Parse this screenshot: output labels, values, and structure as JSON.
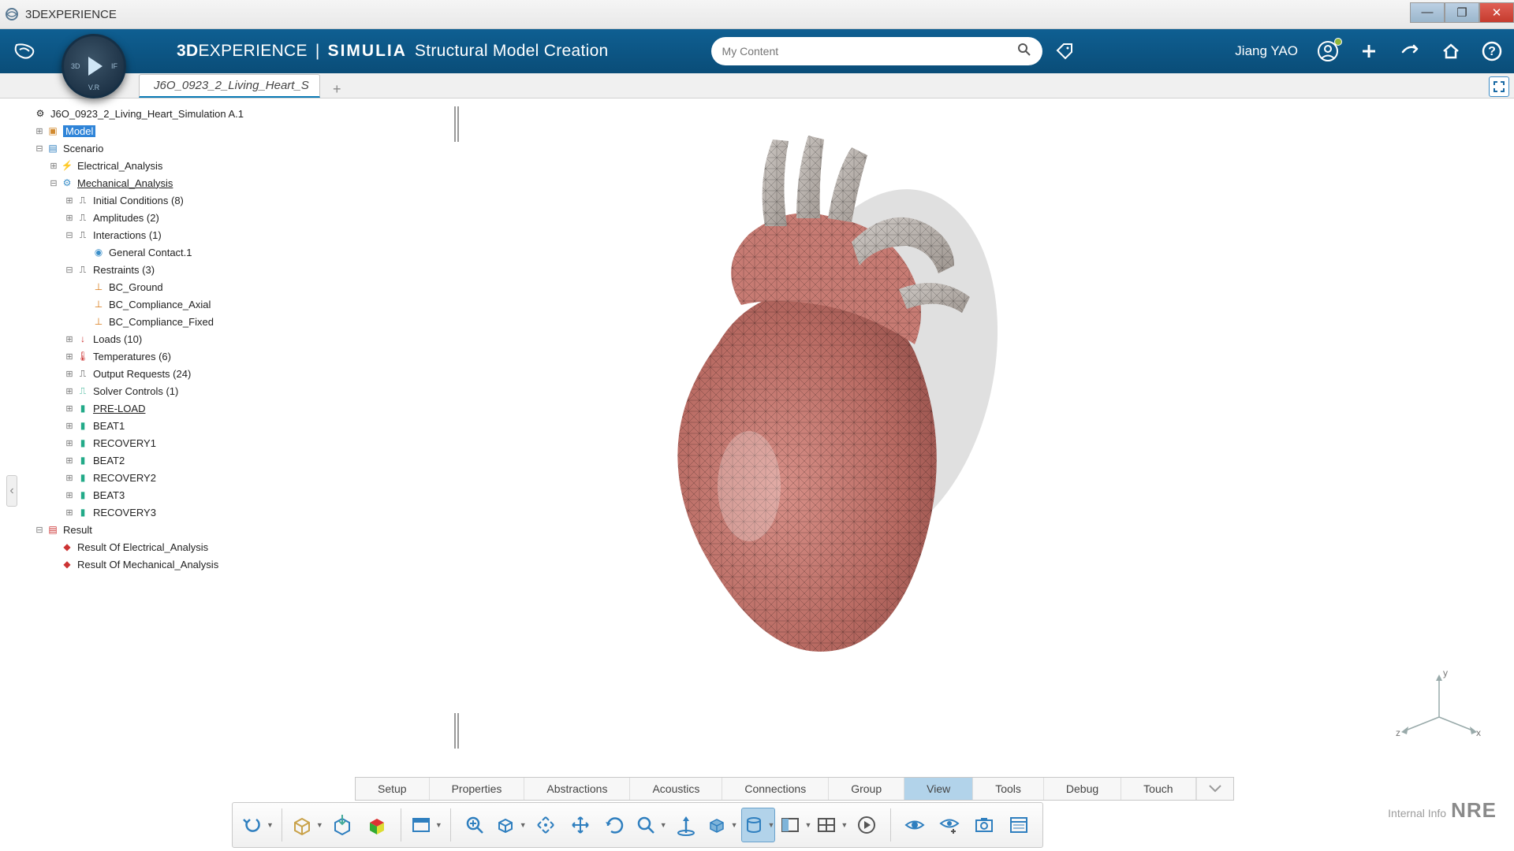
{
  "window": {
    "title": "3DEXPERIENCE"
  },
  "brand": {
    "part1a": "3D",
    "part1b": "EXPERIENCE",
    "sep": "|",
    "part2": "SIMULIA",
    "part3": "Structural Model Creation"
  },
  "compass": {
    "left": "3D",
    "right": "IF",
    "bottom": "V.R"
  },
  "search": {
    "placeholder": "My Content"
  },
  "user": {
    "name": "Jiang YAO"
  },
  "doc_tab": {
    "label": "J6O_0923_2_Living_Heart_S"
  },
  "tree": {
    "root": "J6O_0923_2_Living_Heart_Simulation A.1",
    "model": "Model",
    "scenario": "Scenario",
    "elec": "Electrical_Analysis",
    "mech": "Mechanical_Analysis",
    "init": "Initial Conditions (8)",
    "amp": "Amplitudes (2)",
    "inter": "Interactions (1)",
    "gc": "General Contact.1",
    "restr": "Restraints (3)",
    "bc1": "BC_Ground",
    "bc2": "BC_Compliance_Axial",
    "bc3": "BC_Compliance_Fixed",
    "loads": "Loads (10)",
    "temps": "Temperatures (6)",
    "outreq": "Output Requests (24)",
    "solver": "Solver Controls (1)",
    "preload": "PRE-LOAD",
    "beat1": "BEAT1",
    "rec1": "RECOVERY1",
    "beat2": "BEAT2",
    "rec2": "RECOVERY2",
    "beat3": "BEAT3",
    "rec3": "RECOVERY3",
    "result": "Result",
    "res_elec": "Result Of Electrical_Analysis",
    "res_mech": "Result Of Mechanical_Analysis"
  },
  "triad": {
    "x": "x",
    "y": "y",
    "z": "z"
  },
  "ribbon_tabs": [
    "Setup",
    "Properties",
    "Abstractions",
    "Acoustics",
    "Connections",
    "Group",
    "View",
    "Tools",
    "Debug",
    "Touch"
  ],
  "ribbon_active": "View",
  "footer": {
    "small": "Internal Info",
    "big": "NRE"
  }
}
